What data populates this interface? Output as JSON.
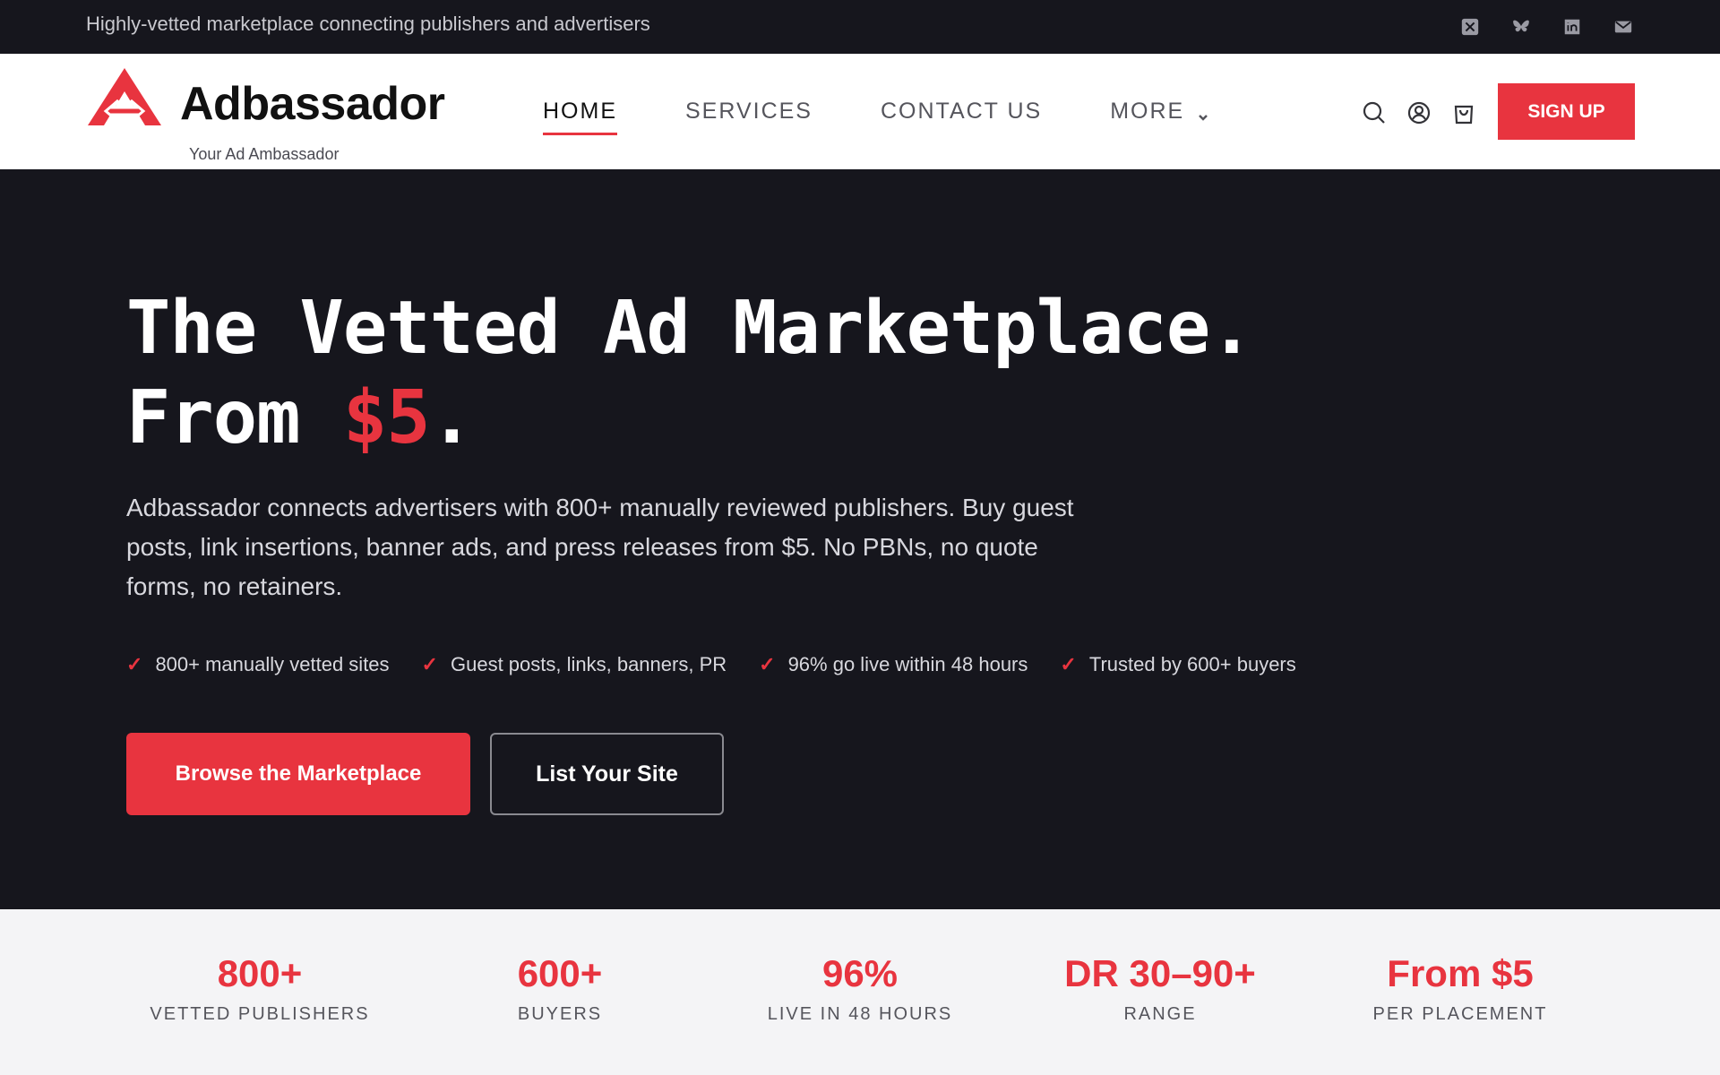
{
  "topbar": {
    "tagline": "Highly-vetted marketplace connecting publishers and advertisers",
    "socials": [
      "x-icon",
      "bluesky-icon",
      "linkedin-icon",
      "mail-icon"
    ]
  },
  "header": {
    "brand": "Adbassador",
    "slogan": "Your Ad Ambassador",
    "nav": [
      {
        "label": "HOME",
        "active": true
      },
      {
        "label": "SERVICES",
        "active": false
      },
      {
        "label": "CONTACT US",
        "active": false
      },
      {
        "label": "MORE",
        "active": false,
        "has_dropdown": true
      }
    ],
    "tools": [
      "search-icon",
      "account-icon",
      "cart-icon"
    ],
    "signup_label": "SIGN UP"
  },
  "hero": {
    "title_line1": "The Vetted Ad Marketplace.",
    "title_line2_prefix": "From ",
    "title_line2_price": "$5",
    "title_line2_suffix": ".",
    "lead": "Adbassador connects advertisers with 800+ manually reviewed publishers. Buy guest posts, link insertions, banner ads, and press releases from $5. No PBNs, no quote forms, no retainers.",
    "checks": [
      "800+ manually vetted sites",
      "Guest posts, links, banners, PR",
      "96% go live within 48 hours",
      "Trusted by 600+ buyers"
    ],
    "check_glyph": "✓",
    "primary_cta": "Browse the Marketplace",
    "secondary_cta": "List Your Site"
  },
  "stats": [
    {
      "value": "800+",
      "label": "VETTED PUBLISHERS"
    },
    {
      "value": "600+",
      "label": "BUYERS"
    },
    {
      "value": "96%",
      "label": "LIVE IN 48 HOURS"
    },
    {
      "value": "DR 30–90+",
      "label": "RANGE"
    },
    {
      "value": "From $5",
      "label": "PER PLACEMENT"
    }
  ],
  "colors": {
    "accent": "#e8343f",
    "dark_bg": "#16161d",
    "stats_bg": "#f4f4f6"
  }
}
